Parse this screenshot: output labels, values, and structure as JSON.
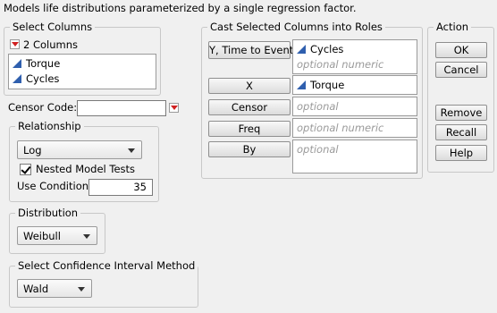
{
  "description": "Models life distributions parameterized by a single regression factor.",
  "select_columns": {
    "legend": "Select Columns",
    "count_label": "2 Columns",
    "columns": [
      {
        "name": "Torque",
        "icon": "continuous-icon"
      },
      {
        "name": "Cycles",
        "icon": "continuous-icon"
      }
    ]
  },
  "censor_code": {
    "label": "Censor Code:",
    "value": ""
  },
  "relationship": {
    "legend": "Relationship",
    "selected": "Log",
    "nested_label": "Nested Model Tests",
    "nested_checked": true,
    "use_condition_label": "Use Condition",
    "use_condition_value": "35"
  },
  "distribution": {
    "legend": "Distribution",
    "selected": "Weibull"
  },
  "ci_method": {
    "legend": "Select Confidence Interval Method",
    "selected": "Wald"
  },
  "cast": {
    "legend": "Cast Selected Columns into Roles",
    "roles": [
      {
        "button": "Y, Time to Event",
        "items": [
          "Cycles"
        ],
        "hint": "optional numeric"
      },
      {
        "button": "X",
        "items": [
          "Torque"
        ],
        "hint": ""
      },
      {
        "button": "Censor",
        "items": [],
        "hint": "optional"
      },
      {
        "button": "Freq",
        "items": [],
        "hint": "optional numeric"
      },
      {
        "button": "By",
        "items": [],
        "hint": "optional"
      }
    ]
  },
  "action": {
    "legend": "Action",
    "ok": "OK",
    "cancel": "Cancel",
    "remove": "Remove",
    "recall": "Recall",
    "help": "Help"
  },
  "colors": {
    "accent_icon": "#2f5fae",
    "red_arrow": "#d02020"
  }
}
